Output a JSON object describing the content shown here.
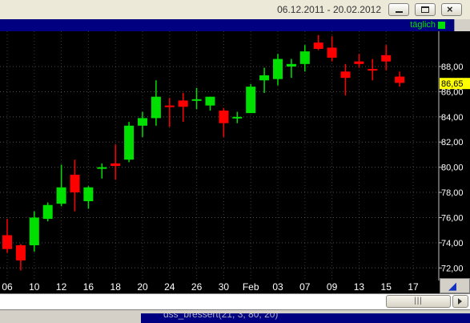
{
  "window": {
    "date_range": "06.12.2011 - 20.02.2012",
    "minimize_icon": "minimize-icon",
    "maximize_icon": "maximize-icon",
    "close_icon": "close-icon"
  },
  "chart": {
    "period_label": "täglich",
    "last_price_label": "86,65"
  },
  "indicator": {
    "title": "dss_bressert(21, 3, 80, 20)"
  },
  "colors": {
    "background": "#000000",
    "header": "#000080",
    "up": "#00e000",
    "down": "#ff0000",
    "axis_text": "#ffffff",
    "price_marker": "#ffff00",
    "grid": "#808080"
  },
  "chart_data": {
    "type": "candlestick",
    "ylim": [
      71.0,
      90.8
    ],
    "y_ticks": [
      {
        "value": 72,
        "label": "72,00"
      },
      {
        "value": 74,
        "label": "74,00"
      },
      {
        "value": 76,
        "label": "76,00"
      },
      {
        "value": 78,
        "label": "78,00"
      },
      {
        "value": 80,
        "label": "80,00"
      },
      {
        "value": 82,
        "label": "82,00"
      },
      {
        "value": 84,
        "label": "84,00"
      },
      {
        "value": 86,
        "label": "86,00"
      },
      {
        "value": 88,
        "label": "88,00"
      }
    ],
    "last_price": 86.65,
    "x_ticks": [
      {
        "index": 0,
        "label": "06"
      },
      {
        "index": 2,
        "label": "10"
      },
      {
        "index": 4,
        "label": "12"
      },
      {
        "index": 6,
        "label": "16"
      },
      {
        "index": 8,
        "label": "18"
      },
      {
        "index": 10,
        "label": "20"
      },
      {
        "index": 12,
        "label": "24"
      },
      {
        "index": 14,
        "label": "26"
      },
      {
        "index": 16,
        "label": "30"
      },
      {
        "index": 18,
        "label": "Feb"
      },
      {
        "index": 20,
        "label": "03"
      },
      {
        "index": 22,
        "label": "07"
      },
      {
        "index": 24,
        "label": "09"
      },
      {
        "index": 26,
        "label": "13"
      },
      {
        "index": 28,
        "label": "15"
      },
      {
        "index": 30,
        "label": "17"
      }
    ],
    "candles": [
      {
        "o": 74.6,
        "h": 75.9,
        "l": 73.2,
        "c": 73.5
      },
      {
        "o": 73.8,
        "h": 73.9,
        "l": 71.8,
        "c": 72.6
      },
      {
        "o": 73.8,
        "h": 76.5,
        "l": 73.3,
        "c": 76.0
      },
      {
        "o": 75.9,
        "h": 77.2,
        "l": 75.7,
        "c": 77.0
      },
      {
        "o": 77.1,
        "h": 80.2,
        "l": 76.9,
        "c": 78.4
      },
      {
        "o": 79.4,
        "h": 80.6,
        "l": 76.5,
        "c": 78.0
      },
      {
        "o": 77.3,
        "h": 78.5,
        "l": 76.7,
        "c": 78.4
      },
      {
        "o": 79.9,
        "h": 80.3,
        "l": 79.1,
        "c": 80.0
      },
      {
        "o": 80.3,
        "h": 81.8,
        "l": 79.0,
        "c": 80.1
      },
      {
        "o": 80.6,
        "h": 83.6,
        "l": 80.4,
        "c": 83.3
      },
      {
        "o": 83.3,
        "h": 84.4,
        "l": 82.4,
        "c": 83.9
      },
      {
        "o": 83.9,
        "h": 86.9,
        "l": 83.3,
        "c": 85.6
      },
      {
        "o": 84.9,
        "h": 85.5,
        "l": 83.2,
        "c": 84.8
      },
      {
        "o": 85.3,
        "h": 85.9,
        "l": 83.6,
        "c": 84.8
      },
      {
        "o": 85.3,
        "h": 86.3,
        "l": 84.6,
        "c": 85.4
      },
      {
        "o": 84.9,
        "h": 85.6,
        "l": 84.5,
        "c": 85.6
      },
      {
        "o": 84.5,
        "h": 84.7,
        "l": 82.4,
        "c": 83.5
      },
      {
        "o": 84.0,
        "h": 84.4,
        "l": 83.5,
        "c": 84.0
      },
      {
        "o": 84.3,
        "h": 86.6,
        "l": 84.3,
        "c": 86.4
      },
      {
        "o": 86.9,
        "h": 87.9,
        "l": 85.9,
        "c": 87.3
      },
      {
        "o": 87.0,
        "h": 89.0,
        "l": 86.5,
        "c": 88.6
      },
      {
        "o": 88.0,
        "h": 88.6,
        "l": 87.1,
        "c": 88.2
      },
      {
        "o": 88.2,
        "h": 89.7,
        "l": 87.6,
        "c": 89.2
      },
      {
        "o": 89.9,
        "h": 90.5,
        "l": 89.3,
        "c": 89.4
      },
      {
        "o": 89.5,
        "h": 90.4,
        "l": 88.4,
        "c": 88.7
      },
      {
        "o": 87.6,
        "h": 88.2,
        "l": 85.7,
        "c": 87.1
      },
      {
        "o": 88.4,
        "h": 89.0,
        "l": 87.9,
        "c": 88.2
      },
      {
        "o": 87.8,
        "h": 88.6,
        "l": 86.9,
        "c": 87.7
      },
      {
        "o": 88.9,
        "h": 89.7,
        "l": 87.7,
        "c": 88.4
      },
      {
        "o": 87.2,
        "h": 87.6,
        "l": 86.4,
        "c": 86.7
      }
    ]
  }
}
